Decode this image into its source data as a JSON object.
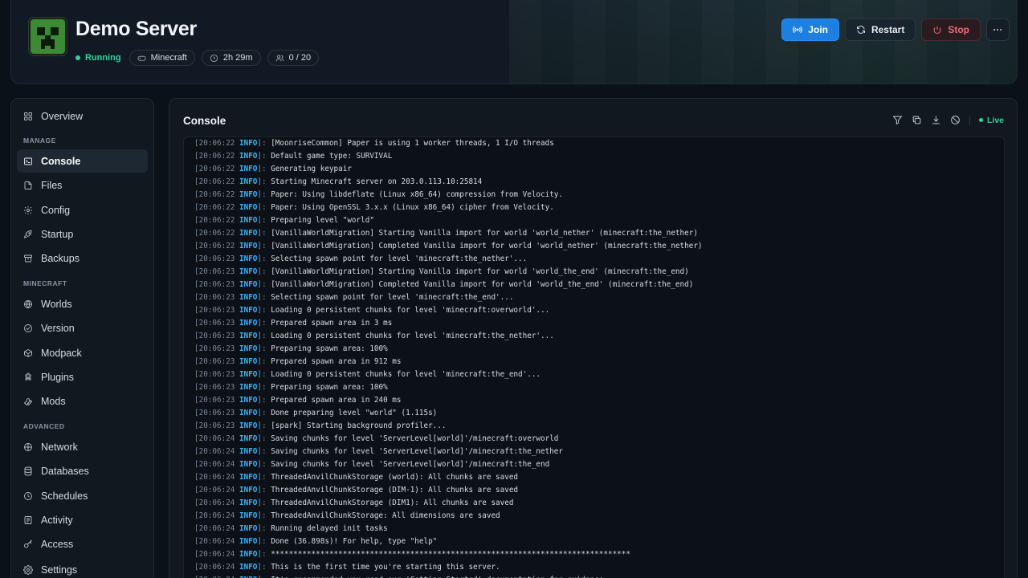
{
  "server": {
    "name": "Demo Server",
    "status": "Running",
    "game": "Minecraft",
    "uptime": "2h 29m",
    "players": "0 / 20"
  },
  "actions": {
    "join": "Join",
    "restart": "Restart",
    "stop": "Stop",
    "more": "···"
  },
  "sidebar": {
    "overview": "Overview",
    "sections": [
      {
        "label": "MANAGE",
        "items": [
          {
            "label": "Console",
            "icon": "terminal-icon",
            "active": true
          },
          {
            "label": "Files",
            "icon": "file-icon"
          },
          {
            "label": "Config",
            "icon": "sliders-icon"
          },
          {
            "label": "Startup",
            "icon": "rocket-icon"
          },
          {
            "label": "Backups",
            "icon": "archive-icon"
          }
        ]
      },
      {
        "label": "MINECRAFT",
        "items": [
          {
            "label": "Worlds",
            "icon": "globe-icon"
          },
          {
            "label": "Version",
            "icon": "version-icon"
          },
          {
            "label": "Modpack",
            "icon": "box-icon"
          },
          {
            "label": "Plugins",
            "icon": "puzzle-icon"
          },
          {
            "label": "Mods",
            "icon": "wrench-icon"
          }
        ]
      },
      {
        "label": "ADVANCED",
        "items": [
          {
            "label": "Network",
            "icon": "network-icon"
          },
          {
            "label": "Databases",
            "icon": "database-icon"
          },
          {
            "label": "Schedules",
            "icon": "clock-icon"
          },
          {
            "label": "Activity",
            "icon": "activity-icon"
          },
          {
            "label": "Access",
            "icon": "key-icon"
          },
          {
            "label": "Settings",
            "icon": "gear-icon"
          }
        ]
      }
    ]
  },
  "console": {
    "title": "Console",
    "live": "Live",
    "lines": [
      {
        "t": "20:06:22",
        "l": "INFO",
        "m": "[MoonriseCommon] Paper is using 1 worker threads, 1 I/O threads"
      },
      {
        "t": "20:06:22",
        "l": "INFO",
        "m": "Default game type: SURVIVAL"
      },
      {
        "t": "20:06:22",
        "l": "INFO",
        "m": "Generating keypair"
      },
      {
        "t": "20:06:22",
        "l": "INFO",
        "m": "Starting Minecraft server on 203.0.113.10:25814"
      },
      {
        "t": "20:06:22",
        "l": "INFO",
        "m": "Paper: Using libdeflate (Linux x86_64) compression from Velocity."
      },
      {
        "t": "20:06:22",
        "l": "INFO",
        "m": "Paper: Using OpenSSL 3.x.x (Linux x86_64) cipher from Velocity."
      },
      {
        "t": "20:06:22",
        "l": "INFO",
        "m": "Preparing level \"world\""
      },
      {
        "t": "20:06:22",
        "l": "INFO",
        "m": "[VanillaWorldMigration] Starting Vanilla import for world 'world_nether' (minecraft:the_nether)"
      },
      {
        "t": "20:06:22",
        "l": "INFO",
        "m": "[VanillaWorldMigration] Completed Vanilla import for world 'world_nether' (minecraft:the_nether)"
      },
      {
        "t": "20:06:23",
        "l": "INFO",
        "m": "Selecting spawn point for level 'minecraft:the_nether'..."
      },
      {
        "t": "20:06:23",
        "l": "INFO",
        "m": "[VanillaWorldMigration] Starting Vanilla import for world 'world_the_end' (minecraft:the_end)"
      },
      {
        "t": "20:06:23",
        "l": "INFO",
        "m": "[VanillaWorldMigration] Completed Vanilla import for world 'world_the_end' (minecraft:the_end)"
      },
      {
        "t": "20:06:23",
        "l": "INFO",
        "m": "Selecting spawn point for level 'minecraft:the_end'..."
      },
      {
        "t": "20:06:23",
        "l": "INFO",
        "m": "Loading 0 persistent chunks for level 'minecraft:overworld'..."
      },
      {
        "t": "20:06:23",
        "l": "INFO",
        "m": "Prepared spawn area in 3 ms"
      },
      {
        "t": "20:06:23",
        "l": "INFO",
        "m": "Loading 0 persistent chunks for level 'minecraft:the_nether'..."
      },
      {
        "t": "20:06:23",
        "l": "INFO",
        "m": "Preparing spawn area: 100%"
      },
      {
        "t": "20:06:23",
        "l": "INFO",
        "m": "Prepared spawn area in 912 ms"
      },
      {
        "t": "20:06:23",
        "l": "INFO",
        "m": "Loading 0 persistent chunks for level 'minecraft:the_end'..."
      },
      {
        "t": "20:06:23",
        "l": "INFO",
        "m": "Preparing spawn area: 100%"
      },
      {
        "t": "20:06:23",
        "l": "INFO",
        "m": "Prepared spawn area in 240 ms"
      },
      {
        "t": "20:06:23",
        "l": "INFO",
        "m": "Done preparing level \"world\" (1.115s)"
      },
      {
        "t": "20:06:23",
        "l": "INFO",
        "m": "[spark] Starting background profiler..."
      },
      {
        "t": "20:06:24",
        "l": "INFO",
        "m": "Saving chunks for level 'ServerLevel[world]'/minecraft:overworld"
      },
      {
        "t": "20:06:24",
        "l": "INFO",
        "m": "Saving chunks for level 'ServerLevel[world]'/minecraft:the_nether"
      },
      {
        "t": "20:06:24",
        "l": "INFO",
        "m": "Saving chunks for level 'ServerLevel[world]'/minecraft:the_end"
      },
      {
        "t": "20:06:24",
        "l": "INFO",
        "m": "ThreadedAnvilChunkStorage (world): All chunks are saved"
      },
      {
        "t": "20:06:24",
        "l": "INFO",
        "m": "ThreadedAnvilChunkStorage (DIM-1): All chunks are saved"
      },
      {
        "t": "20:06:24",
        "l": "INFO",
        "m": "ThreadedAnvilChunkStorage (DIM1): All chunks are saved"
      },
      {
        "t": "20:06:24",
        "l": "INFO",
        "m": "ThreadedAnvilChunkStorage: All dimensions are saved"
      },
      {
        "t": "20:06:24",
        "l": "INFO",
        "m": "Running delayed init tasks"
      },
      {
        "t": "20:06:24",
        "l": "INFO",
        "m": "Done (36.898s)! For help, type \"help\""
      },
      {
        "t": "20:06:24",
        "l": "INFO",
        "m": "********************************************************************************"
      },
      {
        "t": "20:06:24",
        "l": "INFO",
        "m": "This is the first time you're starting this server."
      },
      {
        "t": "20:06:24",
        "l": "INFO",
        "m": "It's recommended you read our 'Getting Started' documentation for guidance."
      }
    ]
  },
  "colors": {
    "accent": "#1d7fe0",
    "running": "#34d399",
    "stop": "#ef6b7a",
    "log_level": "#38b6ff"
  }
}
